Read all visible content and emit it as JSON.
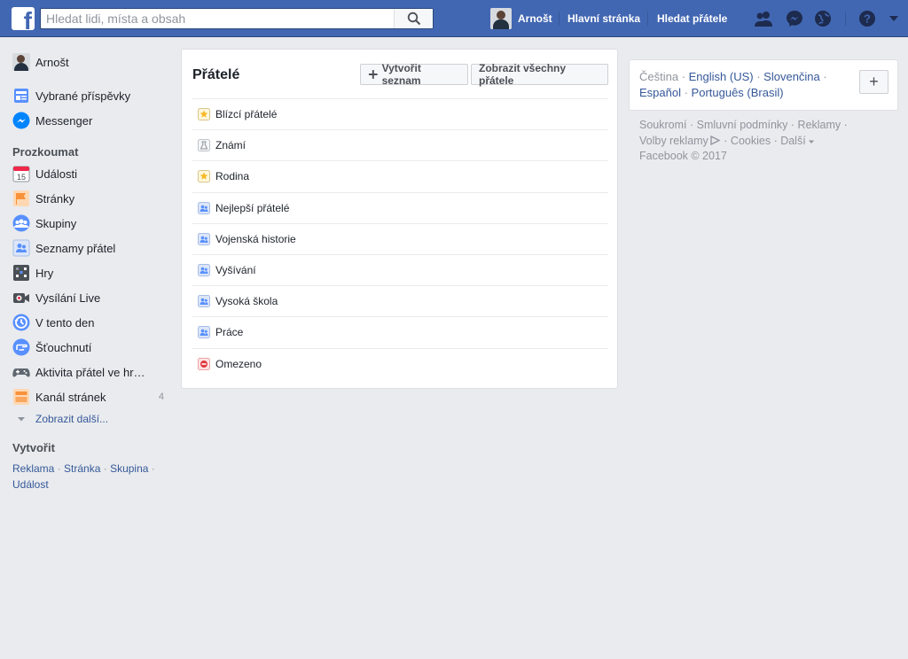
{
  "topbar": {
    "logo": "f",
    "search_placeholder": "Hledat lidi, místa a obsah",
    "user_name": "Arnošt",
    "home_link": "Hlavní stránka",
    "find_friends_link": "Hledat přátele",
    "icons": [
      "friend-requests-icon",
      "messenger-icon",
      "notifications-globe-icon",
      "help-icon",
      "account-menu-caret-icon"
    ]
  },
  "sidebar": {
    "profile_name": "Arnošt",
    "top_items": [
      {
        "label": "Vybrané příspěvky",
        "icon": "news-feed-icon"
      },
      {
        "label": "Messenger",
        "icon": "messenger-icon"
      }
    ],
    "explore_heading": "Prozkoumat",
    "explore_items": [
      {
        "label": "Události",
        "icon": "calendar-icon",
        "calendar_day": "15"
      },
      {
        "label": "Stránky",
        "icon": "flag-icon"
      },
      {
        "label": "Skupiny",
        "icon": "groups-icon"
      },
      {
        "label": "Seznamy přátel",
        "icon": "friend-lists-icon"
      },
      {
        "label": "Hry",
        "icon": "games-icon"
      },
      {
        "label": "Vysílání Live",
        "icon": "live-camera-icon"
      },
      {
        "label": "V tento den",
        "icon": "memories-clock-icon"
      },
      {
        "label": "Šťouchnutí",
        "icon": "poke-icon"
      },
      {
        "label": "Aktivita přátel ve hr…",
        "icon": "gamepad-icon"
      },
      {
        "label": "Kanál stránek",
        "icon": "pages-feed-icon",
        "count": "4"
      }
    ],
    "see_more": "Zobrazit další...",
    "create_heading": "Vytvořit",
    "create_links": [
      "Reklama",
      "Stránka",
      "Skupina",
      "Událost"
    ]
  },
  "friends_card": {
    "title": "Přátelé",
    "create_list_button": "Vytvořit seznam",
    "show_all_button": "Zobrazit všechny přátele",
    "lists": [
      {
        "label": "Blízcí přátelé",
        "icon": "star-icon"
      },
      {
        "label": "Známí",
        "icon": "acquaintance-icon"
      },
      {
        "label": "Rodina",
        "icon": "star-icon"
      },
      {
        "label": "Nejlepší přátelé",
        "icon": "friend-list-icon"
      },
      {
        "label": "Vojenská historie",
        "icon": "friend-list-icon"
      },
      {
        "label": "Vyšívání",
        "icon": "friend-list-icon"
      },
      {
        "label": "Vysoká škola",
        "icon": "friend-list-icon"
      },
      {
        "label": "Práce",
        "icon": "friend-list-icon"
      },
      {
        "label": "Omezeno",
        "icon": "restricted-icon"
      }
    ]
  },
  "languages": {
    "current": "Čeština",
    "options": [
      "English (US)",
      "Slovenčina",
      "Español",
      "Português (Brasil)"
    ],
    "add_button": "+"
  },
  "footer": {
    "links": [
      "Soukromí",
      "Smluvní podmínky",
      "Reklamy",
      "Volby reklamy",
      "Cookies",
      "Další"
    ],
    "copyright": "Facebook © 2017"
  },
  "colors": {
    "topbar": "#4267b2",
    "background": "#e9ebee",
    "link": "#365899"
  }
}
